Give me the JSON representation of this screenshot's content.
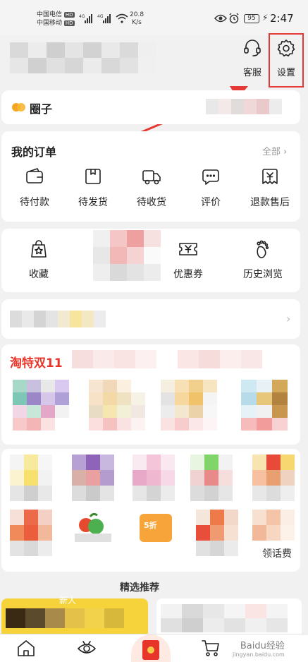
{
  "status": {
    "carrier1": "中国电信",
    "carrier2": "中国移动",
    "hd": "HD",
    "net1": "4G",
    "net2": "4G",
    "speed_value": "20.8",
    "speed_unit": "K/s",
    "battery": "95",
    "time": "2:47"
  },
  "header": {
    "service_label": "客服",
    "settings_label": "设置"
  },
  "circle": {
    "label": "圈子"
  },
  "orders": {
    "title": "我的订单",
    "all_label": "全部",
    "items": [
      {
        "label": "待付款",
        "icon": "wallet-icon"
      },
      {
        "label": "待发货",
        "icon": "box-icon"
      },
      {
        "label": "待收货",
        "icon": "truck-icon"
      },
      {
        "label": "评价",
        "icon": "comment-icon"
      },
      {
        "label": "退款售后",
        "icon": "refund-icon"
      }
    ]
  },
  "tools": {
    "items": [
      {
        "label": "收藏",
        "icon": "star-bag-icon"
      },
      {
        "label": "优惠券",
        "icon": "coupon-icon"
      },
      {
        "label": "历史浏览",
        "icon": "footprint-icon"
      }
    ]
  },
  "promo": {
    "title": "淘特双11",
    "tags": [
      "5折"
    ],
    "partial_labels": [
      "领话费"
    ]
  },
  "recommend": {
    "title": "精选推荐",
    "newbie": "新人"
  },
  "colors": {
    "accent_red": "#e53935",
    "promo_red": "#e8352a"
  },
  "watermark": {
    "text": "Baidu经验",
    "sub": "jingyan.baidu.com"
  }
}
